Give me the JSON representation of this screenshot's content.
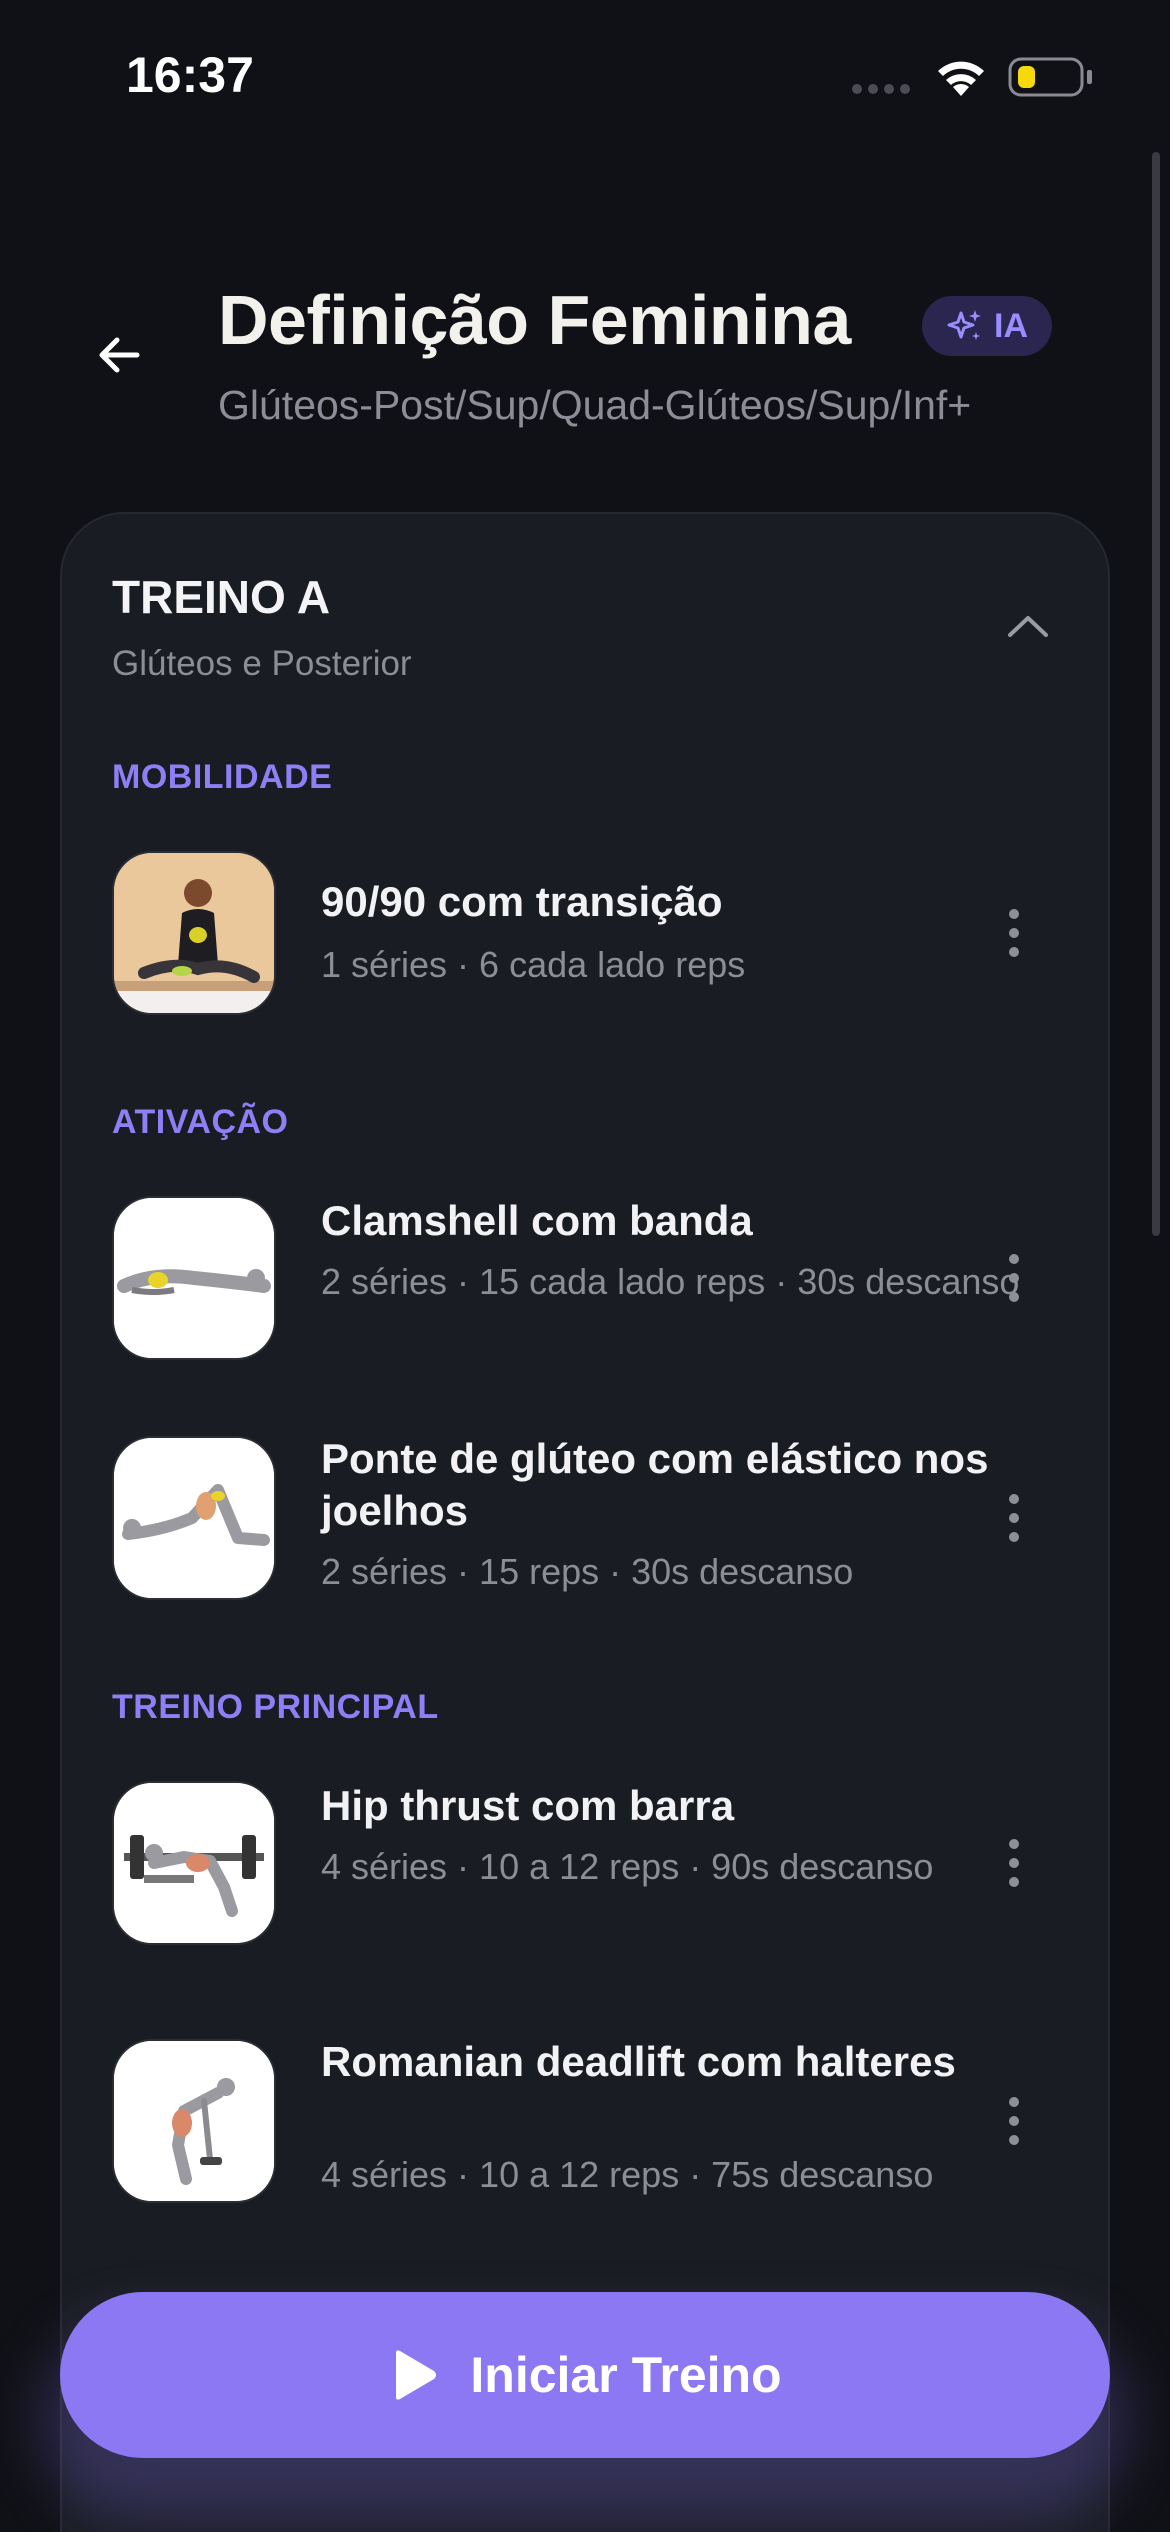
{
  "status_bar": {
    "time": "16:37"
  },
  "header": {
    "title": "Definição Feminina",
    "ai_badge": "IA",
    "subtitle": "Glúteos-Post/Sup/Quad-Glúteos/Sup/Inf+"
  },
  "workout": {
    "name": "TREINO A",
    "focus": "Glúteos e Posterior",
    "sections": [
      {
        "label": "MOBILIDADE",
        "exercises": [
          {
            "name": "90/90 com transição",
            "meta": "1 séries · 6 cada lado reps"
          }
        ]
      },
      {
        "label": "ATIVAÇÃO",
        "exercises": [
          {
            "name": "Clamshell com banda",
            "meta": "2 séries · 15 cada lado reps · 30s descanso"
          },
          {
            "name": "Ponte de glúteo com elástico nos joelhos",
            "meta": "2 séries · 15 reps · 30s descanso"
          }
        ]
      },
      {
        "label": "TREINO PRINCIPAL",
        "exercises": [
          {
            "name": "Hip thrust com barra",
            "meta": "4 séries · 10 a 12 reps · 90s descanso"
          },
          {
            "name": "Romanian deadlift com halteres",
            "meta": "4 séries · 10 a 12 reps · 75s descanso"
          }
        ]
      }
    ]
  },
  "start_button": {
    "label": "Iniciar Treino"
  },
  "colors": {
    "accent": "#8b78f2",
    "background": "#101116",
    "card": "#1a1c23",
    "section_label": "#8f7ff5"
  },
  "icons": {
    "back": "arrow-left-icon",
    "ai": "sparkles-icon",
    "collapse": "chevron-up-icon",
    "more": "more-vertical-icon",
    "start": "play-icon"
  }
}
